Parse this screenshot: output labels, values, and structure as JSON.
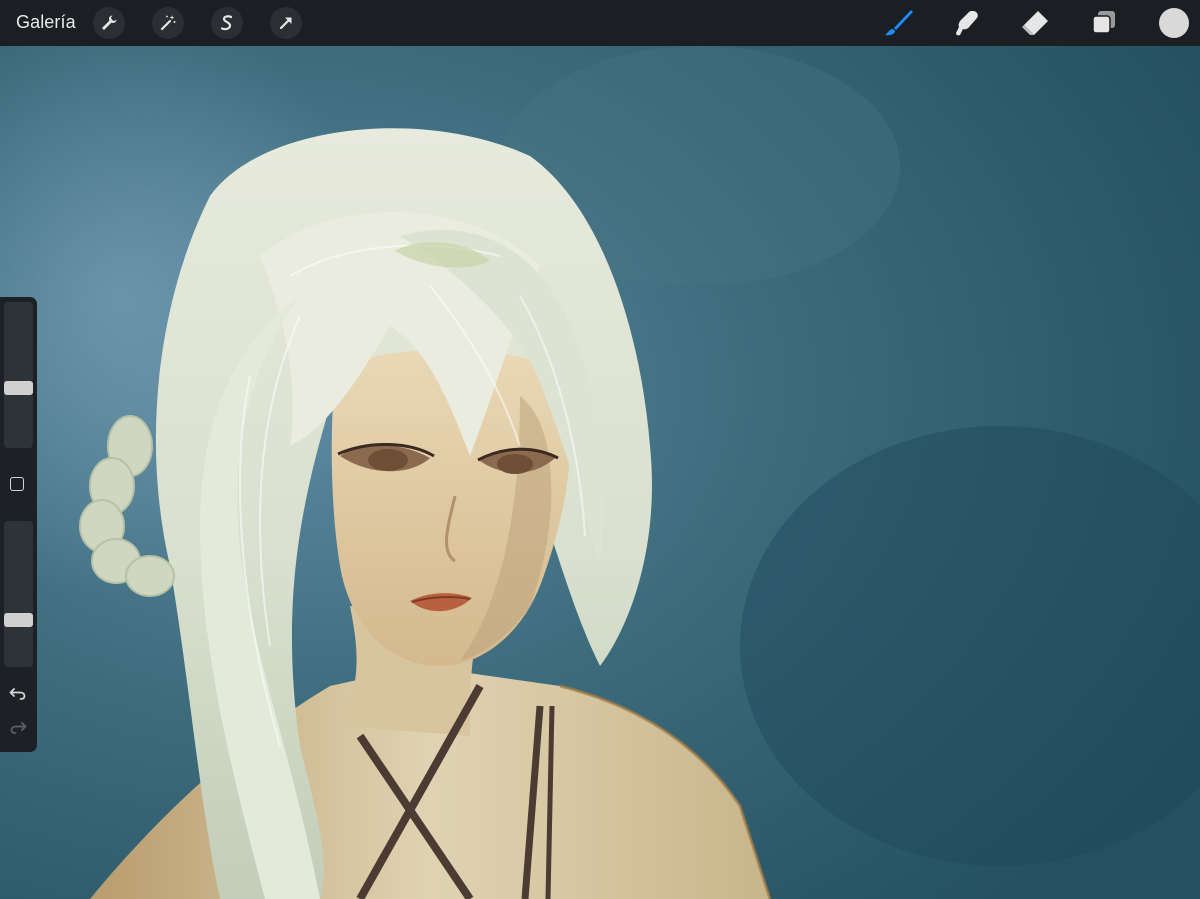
{
  "topbar": {
    "gallery_label": "Galería",
    "left_tools": [
      {
        "name": "adjust-wrench-icon"
      },
      {
        "name": "adjustments-wand-icon"
      },
      {
        "name": "selection-s-icon"
      },
      {
        "name": "transform-arrow-icon"
      }
    ],
    "right_tools": [
      {
        "name": "brush-icon",
        "active": true
      },
      {
        "name": "smudge-icon"
      },
      {
        "name": "eraser-icon"
      },
      {
        "name": "layers-icon"
      }
    ],
    "current_color": "#d9d9d9",
    "accent_color": "#1a8cff"
  },
  "sidebar": {
    "brush_size_level": 0.4,
    "opacity_level": 0.3,
    "undo": "undo-icon",
    "redo": "redo-icon"
  },
  "canvas": {
    "background_color": "#2f5966",
    "artwork": "painting"
  }
}
